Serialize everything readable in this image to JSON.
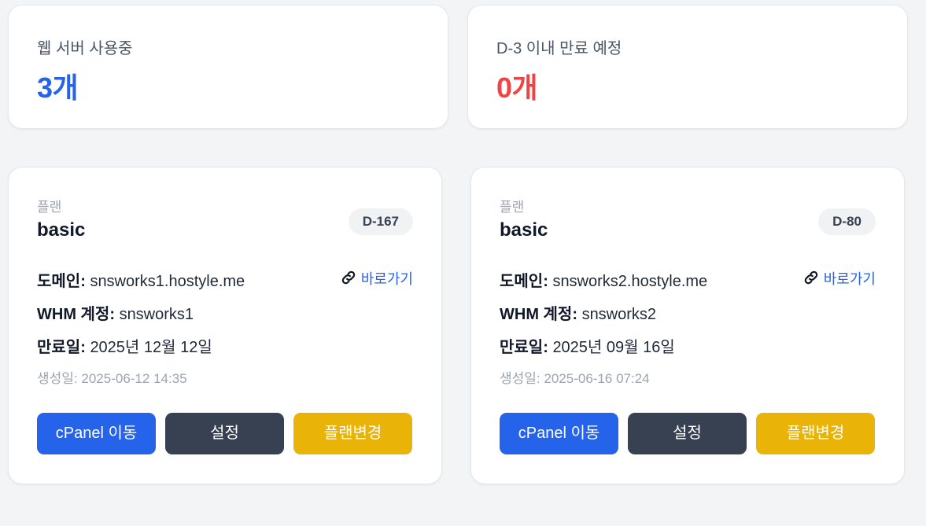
{
  "stats": {
    "active": {
      "label": "웹 서버 사용중",
      "value": "3개"
    },
    "expiring": {
      "label": "D-3 이내 만료 예정",
      "value": "0개"
    }
  },
  "colors": {
    "blue": "#2563eb",
    "red": "#ef4444",
    "dark": "#374151",
    "yellow": "#eab308"
  },
  "servers": [
    {
      "plan_label": "플랜",
      "plan": "basic",
      "dday": "D-167",
      "domain_key": "도메인:",
      "domain": "snsworks1.hostyle.me",
      "shortcut": "바로가기",
      "whm_key": "WHM 계정:",
      "whm": "snsworks1",
      "expire_key": "만료일:",
      "expire": "2025년 12월 12일",
      "created_key": "생성일:",
      "created": "2025-06-12 14:35",
      "buttons": {
        "cpanel": "cPanel 이동",
        "settings": "설정",
        "change_plan": "플랜변경"
      }
    },
    {
      "plan_label": "플랜",
      "plan": "basic",
      "dday": "D-80",
      "domain_key": "도메인:",
      "domain": "snsworks2.hostyle.me",
      "shortcut": "바로가기",
      "whm_key": "WHM 계정:",
      "whm": "snsworks2",
      "expire_key": "만료일:",
      "expire": "2025년 09월 16일",
      "created_key": "생성일:",
      "created": "2025-06-16 07:24",
      "buttons": {
        "cpanel": "cPanel 이동",
        "settings": "설정",
        "change_plan": "플랜변경"
      }
    }
  ]
}
